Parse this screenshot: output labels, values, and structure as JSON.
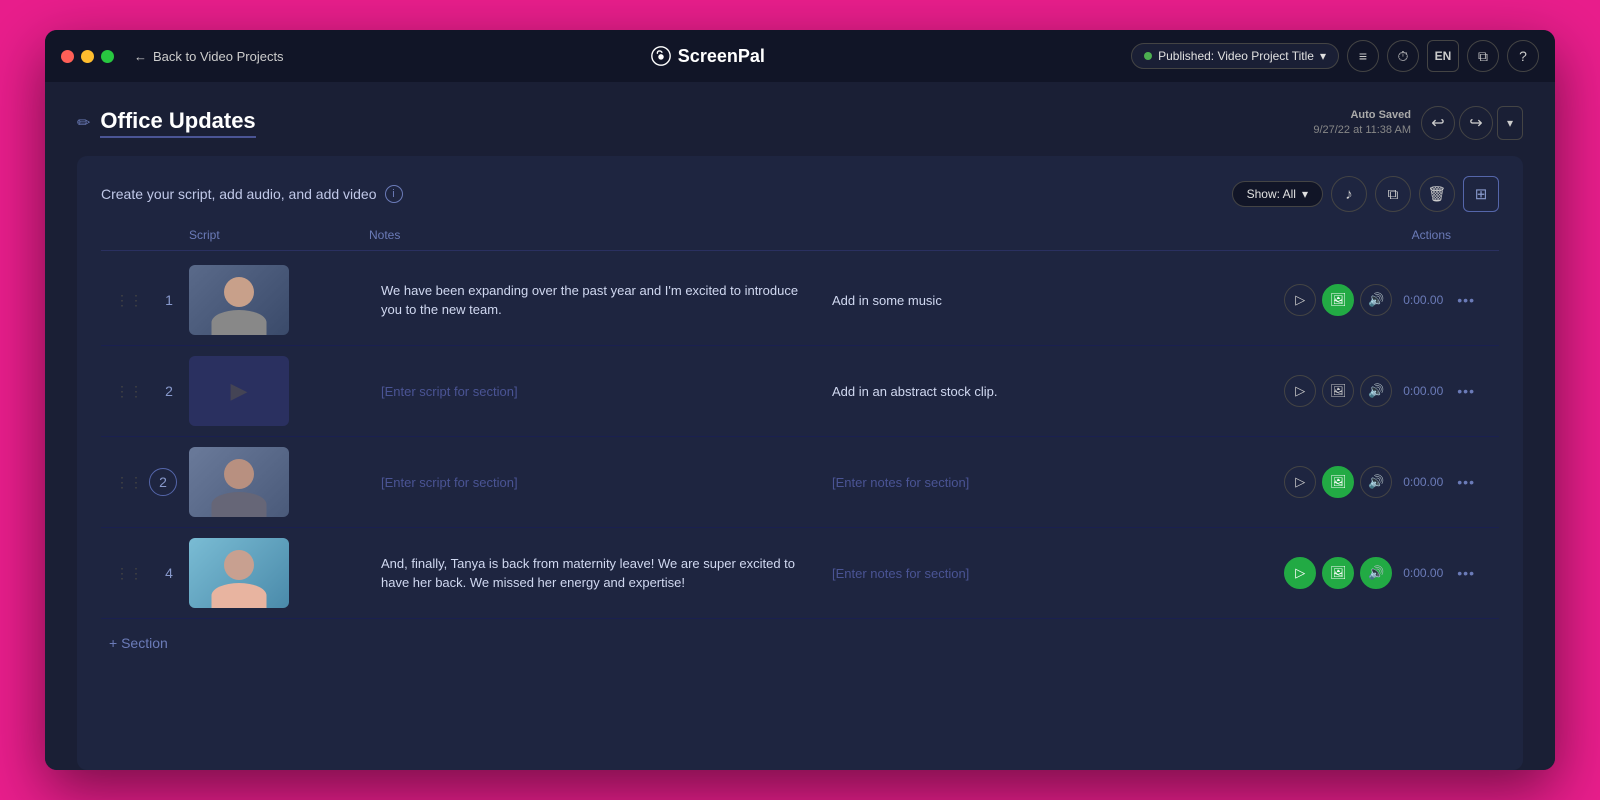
{
  "app": {
    "name": "ScreenPal"
  },
  "titlebar": {
    "back_label": "Back to Video Projects",
    "publish_label": "Published: Video Project Title",
    "lang": "EN"
  },
  "header": {
    "title": "Office Updates",
    "autosave_label": "Auto Saved",
    "autosave_date": "9/27/22 at 11:38 AM"
  },
  "toolbar": {
    "undo_label": "↩",
    "redo_label": "↪"
  },
  "panel": {
    "instructions": "Create your script, add audio, and add video",
    "show_filter": "Show: All",
    "columns": {
      "script": "Script",
      "notes": "Notes",
      "actions": "Actions"
    }
  },
  "sections": [
    {
      "id": 1,
      "number": "1",
      "has_thumbnail": true,
      "thumbnail_type": "person1",
      "script": "We have been expanding over the past year and I'm excited to introduce you to the new team.",
      "notes": "Add in some music",
      "has_video": true,
      "has_image": true,
      "has_audio": false,
      "time": "0:00.00"
    },
    {
      "id": 2,
      "number": "2",
      "has_thumbnail": false,
      "thumbnail_type": "placeholder",
      "script": "[Enter script for section]",
      "notes": "Add in an abstract stock clip.",
      "has_video": false,
      "has_image": false,
      "has_audio": false,
      "time": "0:00.00"
    },
    {
      "id": 3,
      "number": "2",
      "active": true,
      "has_thumbnail": true,
      "thumbnail_type": "person2",
      "script": "[Enter script for section]",
      "notes": "[Enter notes for section]",
      "has_video": false,
      "has_image": true,
      "has_audio": false,
      "time": "0:00.00"
    },
    {
      "id": 4,
      "number": "4",
      "has_thumbnail": true,
      "thumbnail_type": "person3",
      "script": "And, finally, Tanya is back from maternity leave! We are super excited to have her back. We missed her energy and expertise!",
      "notes": "[Enter notes for section]",
      "has_video": true,
      "has_image": true,
      "has_audio": true,
      "time": "0:00.00"
    }
  ],
  "add_section_label": "+ Section"
}
